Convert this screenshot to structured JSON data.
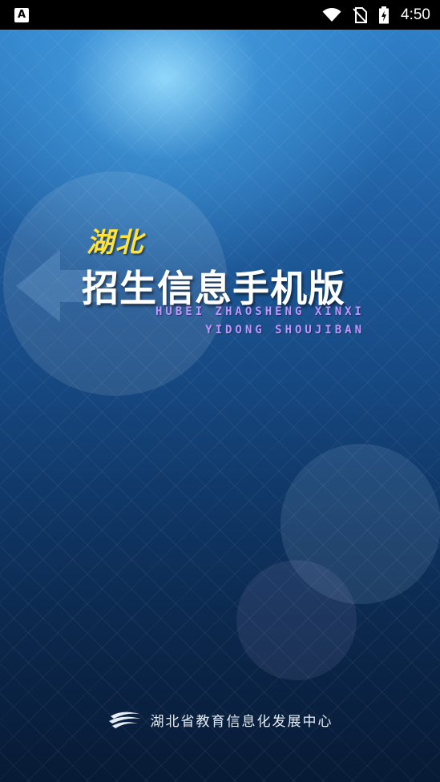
{
  "status_bar": {
    "time": "4:50",
    "left_icon_letter": "A",
    "icons": [
      "wifi-icon",
      "no-sim-icon",
      "battery-charging-icon"
    ]
  },
  "splash": {
    "title_region": "湖北",
    "title_main": "招生信息手机版",
    "pinyin_line1": "HUBEI ZHAOSHENG XINXI",
    "pinyin_line2": "YIDONG SHOUJIBAN",
    "footer_org": "湖北省教育信息化发展中心"
  },
  "colors": {
    "title_region": "#ffe23a",
    "title_main": "#ffffff",
    "pinyin": "#c394ff",
    "background_top": "#2f7fc7",
    "background_bottom": "#071a35"
  }
}
